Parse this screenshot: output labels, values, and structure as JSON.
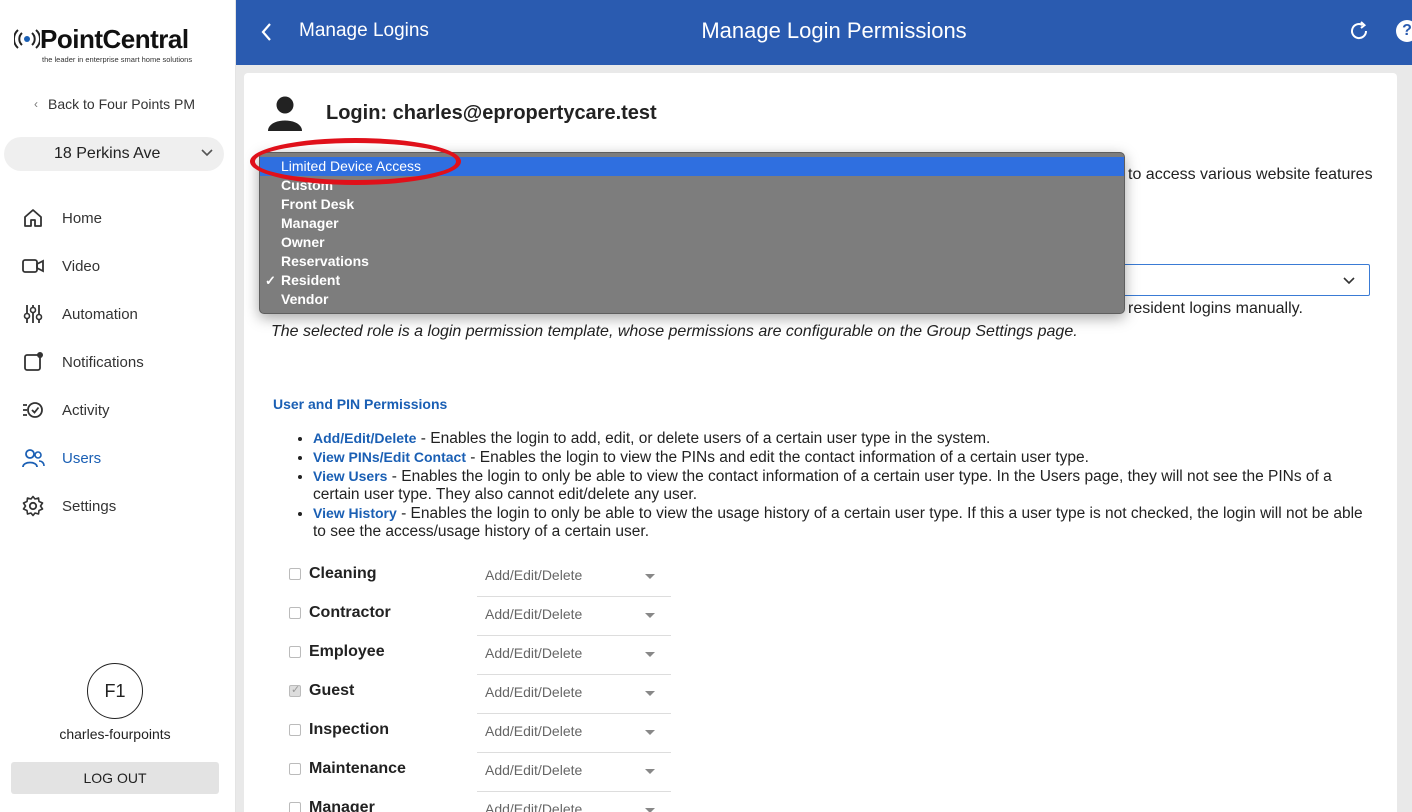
{
  "sidebar": {
    "logo_text": "PointCentral",
    "logo_tagline": "the leader in enterprise smart home solutions",
    "back_link": "Back to Four Points PM",
    "property": "18 Perkins Ave",
    "nav": [
      {
        "label": "Home",
        "icon": "home-icon"
      },
      {
        "label": "Video",
        "icon": "video-icon"
      },
      {
        "label": "Automation",
        "icon": "sliders-icon"
      },
      {
        "label": "Notifications",
        "icon": "bell-icon"
      },
      {
        "label": "Activity",
        "icon": "activity-icon"
      },
      {
        "label": "Users",
        "icon": "users-icon",
        "active": true
      },
      {
        "label": "Settings",
        "icon": "gear-icon"
      }
    ],
    "avatar_initials": "F1",
    "username": "charles-fourpoints",
    "logout": "LOG OUT"
  },
  "header": {
    "crumb": "Manage Logins",
    "title": "Manage Login Permissions",
    "help": "?"
  },
  "main": {
    "login_heading": "Login: charles@epropertycare.test",
    "desc_right": "to access various website features",
    "help_text_1": "resident logins manually.",
    "help_text_2": "The selected role is a login permission template, whose permissions are configurable on the Group Settings page.",
    "section_title": "User and PIN Permissions",
    "permissions": [
      {
        "term": "Add/Edit/Delete",
        "text": " - Enables the login to add, edit, or delete users of a certain user type in the system."
      },
      {
        "term": "View PINs/Edit Contact",
        "text": " - Enables the login to view the PINs and edit the contact information of a certain user type."
      },
      {
        "term": "View Users",
        "text": " - Enables the login to only be able to view the contact information of a certain user type. In the Users page, they will not see the PINs of a certain user type. They also cannot edit/delete any user."
      },
      {
        "term": "View History",
        "text": " - Enables the login to only be able to view the usage history of a certain user type. If this a user type is not checked, the login will not be able to see the access/usage history of a certain user."
      }
    ],
    "user_types": [
      {
        "name": "Cleaning",
        "permission": "Add/Edit/Delete",
        "checked": false
      },
      {
        "name": "Contractor",
        "permission": "Add/Edit/Delete",
        "checked": false
      },
      {
        "name": "Employee",
        "permission": "Add/Edit/Delete",
        "checked": false
      },
      {
        "name": "Guest",
        "permission": "Add/Edit/Delete",
        "checked": true
      },
      {
        "name": "Inspection",
        "permission": "Add/Edit/Delete",
        "checked": false
      },
      {
        "name": "Maintenance",
        "permission": "Add/Edit/Delete",
        "checked": false
      },
      {
        "name": "Manager",
        "permission": "Add/Edit/Delete",
        "checked": false
      }
    ]
  },
  "dropdown": {
    "options": [
      {
        "label": "Limited Device Access",
        "highlighted": true
      },
      {
        "label": "Custom"
      },
      {
        "label": "Front Desk"
      },
      {
        "label": "Manager"
      },
      {
        "label": "Owner"
      },
      {
        "label": "Reservations"
      },
      {
        "label": "Resident",
        "selected": true
      },
      {
        "label": "Vendor"
      }
    ],
    "selected_mark": "✓"
  },
  "colors": {
    "header_blue": "#2a5bb0",
    "link_blue": "#1a5fb4",
    "highlight_blue": "#2f6fe0",
    "annotation_red": "#e0101a"
  }
}
